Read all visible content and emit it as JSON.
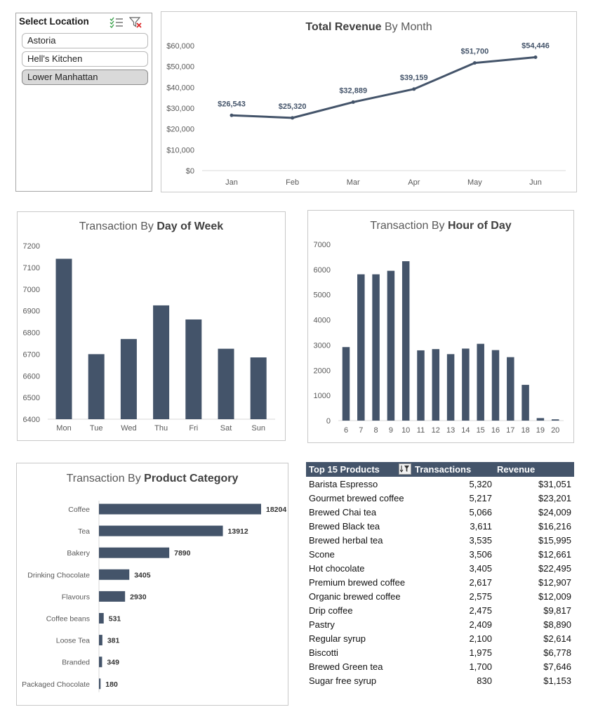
{
  "slicer": {
    "title": "Select Location",
    "items": [
      {
        "label": "Astoria",
        "selected": false
      },
      {
        "label": "Hell's Kitchen",
        "selected": false
      },
      {
        "label": "Lower Manhattan",
        "selected": true
      }
    ]
  },
  "colors": {
    "bar": "#44546a",
    "line": "#44546a",
    "grid": "#d9d9d9"
  },
  "charts": {
    "revenue": {
      "title_bold": "Total Revenue",
      "title_rest": " By Month"
    },
    "dow": {
      "title_rest": "Transaction By ",
      "title_bold": "Day of Week"
    },
    "hod": {
      "title_rest": "Transaction By ",
      "title_bold": "Hour of Day"
    },
    "cat": {
      "title_rest": "Transaction By ",
      "title_bold": "Product Category"
    }
  },
  "chart_data": [
    {
      "type": "line",
      "title": "Total Revenue By Month",
      "categories": [
        "Jan",
        "Feb",
        "Mar",
        "Apr",
        "May",
        "Jun"
      ],
      "values": [
        26543,
        25320,
        32889,
        39159,
        51700,
        54446
      ],
      "labels": [
        "$26,543",
        "$25,320",
        "$32,889",
        "$39,159",
        "$51,700",
        "$54,446"
      ],
      "ylim": [
        0,
        60000
      ],
      "yticks": [
        "$0",
        "$10,000",
        "$20,000",
        "$30,000",
        "$40,000",
        "$50,000",
        "$60,000"
      ],
      "grid": false
    },
    {
      "type": "bar",
      "title": "Transaction By Day of Week",
      "categories": [
        "Mon",
        "Tue",
        "Wed",
        "Thu",
        "Fri",
        "Sat",
        "Sun"
      ],
      "values": [
        7140,
        6700,
        6770,
        6925,
        6860,
        6725,
        6685
      ],
      "ylim": [
        6400,
        7200
      ],
      "yticks": [
        "6400",
        "6500",
        "6600",
        "6700",
        "6800",
        "6900",
        "7000",
        "7100",
        "7200"
      ]
    },
    {
      "type": "bar",
      "title": "Transaction By Hour of Day",
      "categories": [
        "6",
        "7",
        "8",
        "9",
        "10",
        "11",
        "12",
        "13",
        "14",
        "15",
        "16",
        "17",
        "18",
        "19",
        "20"
      ],
      "values": [
        2920,
        5810,
        5810,
        5950,
        6330,
        2790,
        2840,
        2640,
        2860,
        3050,
        2800,
        2520,
        1420,
        100,
        50
      ],
      "ylim": [
        0,
        7000
      ],
      "yticks": [
        "0",
        "1000",
        "2000",
        "3000",
        "4000",
        "5000",
        "6000",
        "7000"
      ]
    },
    {
      "type": "bar",
      "orientation": "horizontal",
      "title": "Transaction By Product Category",
      "categories": [
        "Coffee",
        "Tea",
        "Bakery",
        "Drinking Chocolate",
        "Flavours",
        "Coffee beans",
        "Loose Tea",
        "Branded",
        "Packaged Chocolate"
      ],
      "values": [
        18204,
        13912,
        7890,
        3405,
        2930,
        531,
        381,
        349,
        180
      ]
    }
  ],
  "table": {
    "headers": [
      "Top 15 Products",
      "Transactions",
      "Revenue"
    ],
    "rows": [
      [
        "Barista Espresso",
        "5,320",
        "$31,051"
      ],
      [
        "Gourmet brewed coffee",
        "5,217",
        "$23,201"
      ],
      [
        "Brewed Chai tea",
        "5,066",
        "$24,009"
      ],
      [
        "Brewed Black tea",
        "3,611",
        "$16,216"
      ],
      [
        "Brewed herbal tea",
        "3,535",
        "$15,995"
      ],
      [
        "Scone",
        "3,506",
        "$12,661"
      ],
      [
        "Hot chocolate",
        "3,405",
        "$22,495"
      ],
      [
        "Premium brewed coffee",
        "2,617",
        "$12,907"
      ],
      [
        "Organic brewed coffee",
        "2,575",
        "$12,009"
      ],
      [
        "Drip coffee",
        "2,475",
        "$9,817"
      ],
      [
        "Pastry",
        "2,409",
        "$8,890"
      ],
      [
        "Regular syrup",
        "2,100",
        "$2,614"
      ],
      [
        "Biscotti",
        "1,975",
        "$6,778"
      ],
      [
        "Brewed Green tea",
        "1,700",
        "$7,646"
      ],
      [
        "Sugar free syrup",
        "830",
        "$1,153"
      ]
    ]
  }
}
